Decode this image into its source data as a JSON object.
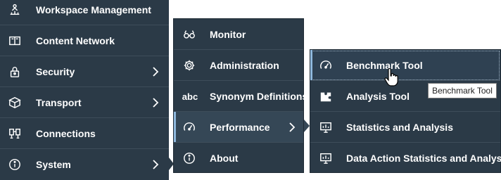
{
  "main_menu": {
    "items": [
      {
        "label": "Workspace Management",
        "icon": "workspace-icon",
        "has_submenu": false
      },
      {
        "label": "Content Network",
        "icon": "book-icon",
        "has_submenu": false
      },
      {
        "label": "Security",
        "icon": "lock-icon",
        "has_submenu": true
      },
      {
        "label": "Transport",
        "icon": "box-icon",
        "has_submenu": true
      },
      {
        "label": "Connections",
        "icon": "connections-icon",
        "has_submenu": false
      },
      {
        "label": "System",
        "icon": "info-icon",
        "has_submenu": true,
        "open": true
      }
    ]
  },
  "system_submenu": {
    "items": [
      {
        "label": "Monitor",
        "icon": "glasses-icon"
      },
      {
        "label": "Administration",
        "icon": "gear-icon"
      },
      {
        "label": "Synonym Definitions",
        "icon": "abc-icon",
        "icon_text": "abc"
      },
      {
        "label": "Performance",
        "icon": "gauge-icon",
        "has_submenu": true,
        "selected": true
      },
      {
        "label": "About",
        "icon": "info-icon"
      }
    ]
  },
  "performance_submenu": {
    "items": [
      {
        "label": "Benchmark Tool",
        "icon": "gauge-icon",
        "hovered": true
      },
      {
        "label": "Analysis Tool",
        "icon": "puzzle-icon"
      },
      {
        "label": "Statistics and Analysis",
        "icon": "presentation-chart-icon"
      },
      {
        "label": "Data Action Statistics and Analysis",
        "icon": "presentation-chart-icon"
      }
    ]
  },
  "tooltip": {
    "text": "Benchmark Tool"
  },
  "colors": {
    "menu_bg": "#2b3a47",
    "selected_bg": "#354756",
    "accent": "#8fb8dd"
  }
}
